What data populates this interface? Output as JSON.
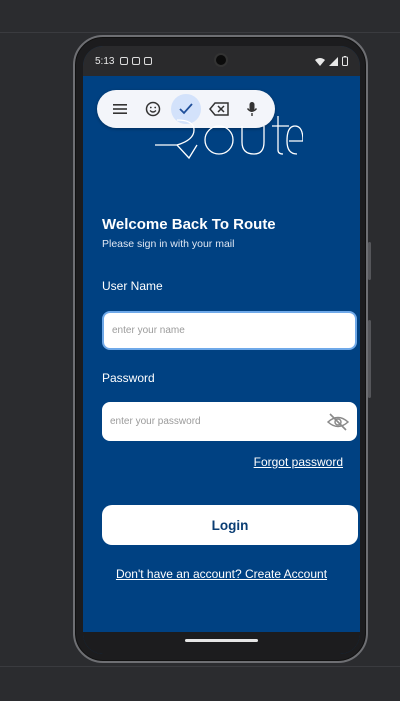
{
  "status": {
    "time": "5:13"
  },
  "keyboard_toolbar": {
    "icons": [
      "menu-icon",
      "emoji-icon",
      "check-icon",
      "backspace-icon",
      "mic-icon"
    ]
  },
  "brand": {
    "logo_text": "Route"
  },
  "header": {
    "title": "Welcome Back To Route",
    "subtitle": "Please sign in with your mail"
  },
  "form": {
    "username_label": "User Name",
    "username_placeholder": "enter your name",
    "username_value": "",
    "password_label": "Password",
    "password_placeholder": "enter your password",
    "password_value": "",
    "forgot_label": "Forgot password",
    "login_label": "Login",
    "signup_label": "Don't have an account? Create Account"
  },
  "colors": {
    "background": "#004182",
    "button_text": "#0a3d73",
    "focus_border": "#6fa9e9",
    "keyboard_bar": "#f3f5fa"
  }
}
